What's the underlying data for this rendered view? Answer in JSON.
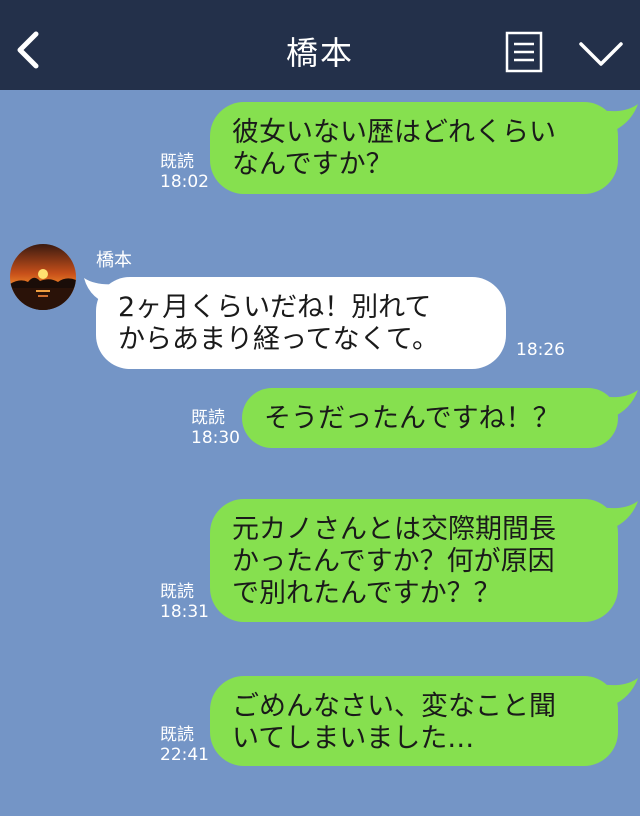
{
  "header": {
    "title": "橋本",
    "back_icon": "chevron-left-icon",
    "menu_icon": "notes-icon",
    "collapse_icon": "chevron-down-icon"
  },
  "colors": {
    "header_bg": "#23304a",
    "chat_bg": "#7495c6",
    "outgoing_bubble": "#86e04f",
    "incoming_bubble": "#ffffff"
  },
  "messages": [
    {
      "direction": "out",
      "text": "彼女いない歴はどれくらい\nなんですか？",
      "read": "既読",
      "time": "18:02"
    },
    {
      "direction": "in",
      "sender": "橋本",
      "text": "2ヶ月くらいだね！別れて\nからあまり経ってなくて。",
      "time": "18:26"
    },
    {
      "direction": "out",
      "text": "そうだったんですね！？",
      "read": "既読",
      "time": "18:30"
    },
    {
      "direction": "out",
      "text": "元カノさんとは交際期間長\nかったんですか？何が原因\nで別れたんですか？？",
      "read": "既読",
      "time": "18:31"
    },
    {
      "direction": "out",
      "text": "ごめんなさい、変なこと聞\nいてしまいました…",
      "read": "既読",
      "time": "22:41"
    }
  ]
}
